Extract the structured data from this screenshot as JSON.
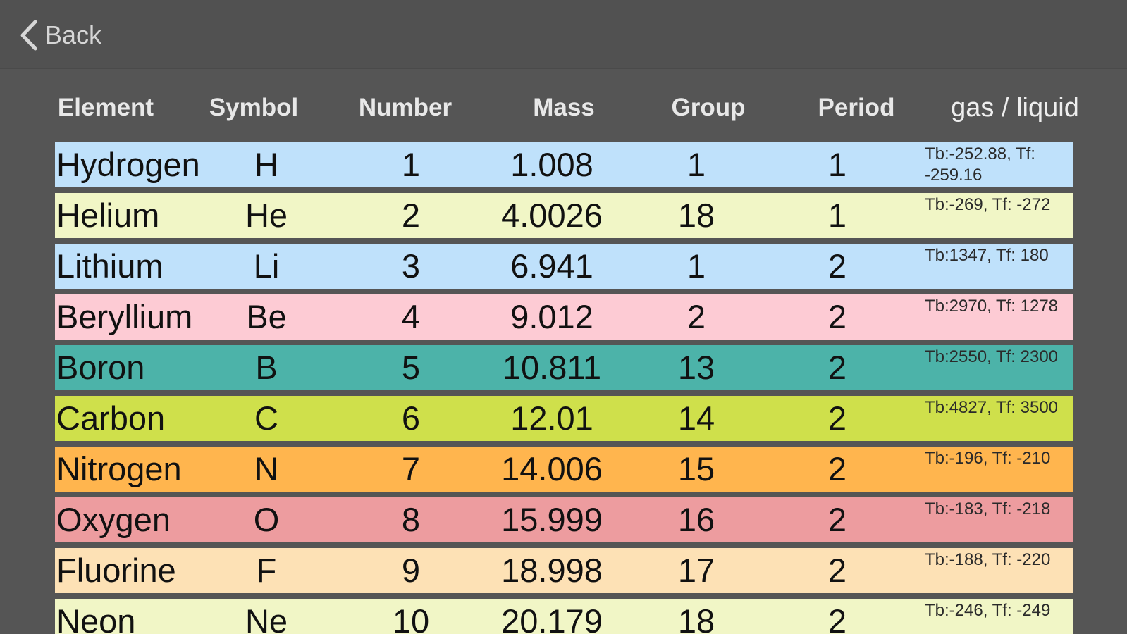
{
  "nav": {
    "back_label": "Back"
  },
  "table": {
    "headers": [
      "Element",
      "Symbol",
      "Number",
      "Mass",
      "Group",
      "Period",
      "gas / liquid"
    ],
    "rows": [
      {
        "name": "Hydrogen",
        "symbol": "H",
        "number": "1",
        "mass": "1.008",
        "group": "1",
        "period": "1",
        "state": "Tb:-252.88, Tf: -259.16",
        "color": "#bfe1fb"
      },
      {
        "name": "Helium",
        "symbol": "He",
        "number": "2",
        "mass": "4.0026",
        "group": "18",
        "period": "1",
        "state": "Tb:-269, Tf: -272",
        "color": "#f1f6c6"
      },
      {
        "name": "Lithium",
        "symbol": "Li",
        "number": "3",
        "mass": "6.941",
        "group": "1",
        "period": "2",
        "state": "Tb:1347, Tf: 180",
        "color": "#bfe1fb"
      },
      {
        "name": "Beryllium",
        "symbol": "Be",
        "number": "4",
        "mass": "9.012",
        "group": "2",
        "period": "2",
        "state": "Tb:2970, Tf: 1278",
        "color": "#fdcbd4"
      },
      {
        "name": "Boron",
        "symbol": "B",
        "number": "5",
        "mass": "10.811",
        "group": "13",
        "period": "2",
        "state": "Tb:2550, Tf: 2300",
        "color": "#4cb3a9"
      },
      {
        "name": "Carbon",
        "symbol": "C",
        "number": "6",
        "mass": "12.01",
        "group": "14",
        "period": "2",
        "state": "Tb:4827, Tf: 3500",
        "color": "#cfe04b"
      },
      {
        "name": "Nitrogen",
        "symbol": "N",
        "number": "7",
        "mass": "14.006",
        "group": "15",
        "period": "2",
        "state": "Tb:-196, Tf: -210",
        "color": "#ffb54e"
      },
      {
        "name": "Oxygen",
        "symbol": "O",
        "number": "8",
        "mass": "15.999",
        "group": "16",
        "period": "2",
        "state": "Tb:-183, Tf: -218",
        "color": "#ed9c9f"
      },
      {
        "name": "Fluorine",
        "symbol": "F",
        "number": "9",
        "mass": "18.998",
        "group": "17",
        "period": "2",
        "state": "Tb:-188, Tf: -220",
        "color": "#fde1b5"
      },
      {
        "name": "Neon",
        "symbol": "Ne",
        "number": "10",
        "mass": "20.179",
        "group": "18",
        "period": "2",
        "state": "Tb:-246, Tf: -249",
        "color": "#f1f6c6"
      }
    ]
  }
}
